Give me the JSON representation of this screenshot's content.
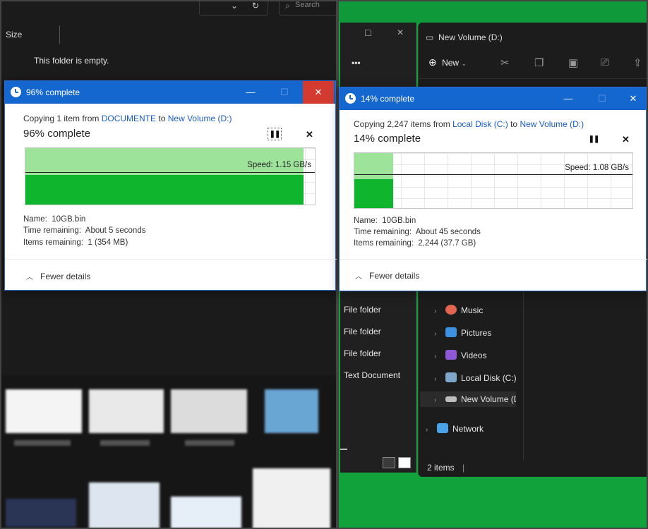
{
  "left_explorer": {
    "search_placeholder": "Search",
    "column_size": "Size",
    "empty_message": "This folder is empty."
  },
  "dialog_left": {
    "title": "96% complete",
    "copy_prefix": "Copying 1 item from ",
    "source": "DOCUMENTE",
    "to_word": " to ",
    "destination": "New Volume (D:)",
    "percent_text": "96% complete",
    "progress": 0.96,
    "speed": "Speed: 1.15 GB/s",
    "name_label": "Name:",
    "name_value": "10GB.bin",
    "time_label": "Time remaining:",
    "time_value": "About 5 seconds",
    "items_label": "Items remaining:",
    "items_value": "1 (354 MB)",
    "fewer_details": "Fewer details"
  },
  "dialog_right": {
    "title": "14% complete",
    "copy_prefix": "Copying 2,247 items from ",
    "source": "Local Disk (C:)",
    "to_word": " to ",
    "destination": "New Volume (D:)",
    "percent_text": "14% complete",
    "progress": 0.14,
    "speed": "Speed: 1.08 GB/s",
    "name_label": "Name:",
    "name_value": "10GB.bin",
    "time_label": "Time remaining:",
    "time_value": "About 45 seconds",
    "items_label": "Items remaining:",
    "items_value": "2,244 (37.7 GB)",
    "fewer_details": "Fewer details"
  },
  "right_explorer": {
    "tab_title": "New Volume (D:)",
    "new_button": "New",
    "nav": {
      "music": "Music",
      "pictures": "Pictures",
      "videos": "Videos",
      "local_disk": "Local Disk (C:)",
      "new_volume": "New Volume (D:)",
      "network": "Network"
    },
    "status_items": "2 items",
    "back_window_files": [
      "File folder",
      "File folder",
      "File folder",
      "Text Document"
    ]
  },
  "colors": {
    "title_blue": "#1467cf",
    "progress_green": "#10b52e",
    "progress_light": "#9ee39a",
    "desktop_green": "#12a23c",
    "close_red": "#d33b30"
  }
}
